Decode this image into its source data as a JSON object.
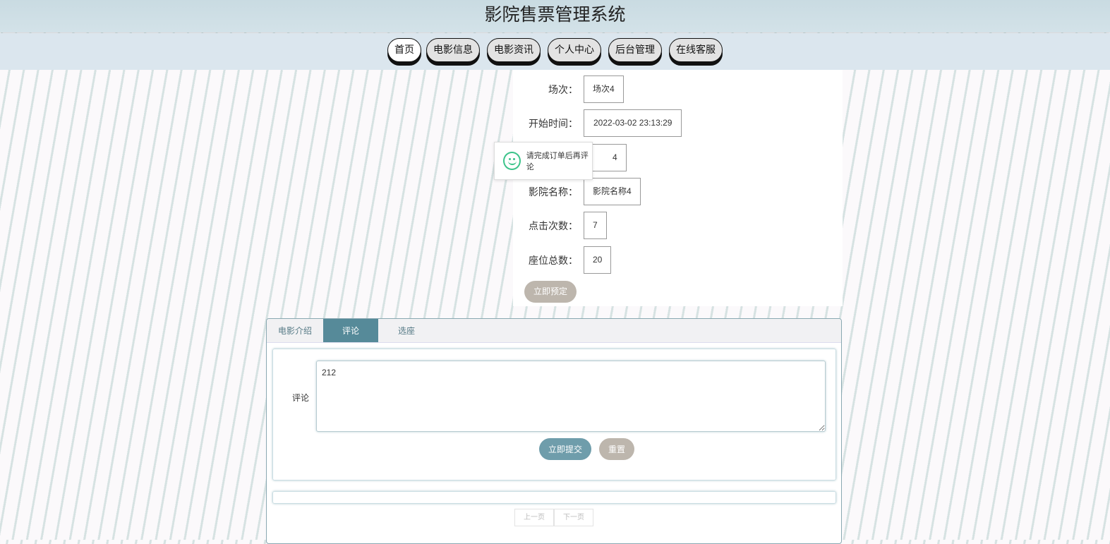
{
  "header": {
    "title": "影院售票管理系统"
  },
  "nav": [
    "首页",
    "电影信息",
    "电影资讯",
    "个人中心",
    "后台管理",
    "在线客服"
  ],
  "fields": [
    {
      "label": "场次：",
      "value": "场次4"
    },
    {
      "label": "开始时间：",
      "value": "2022-03-02 23:13:29"
    },
    {
      "label": "",
      "value": "4"
    },
    {
      "label": "影院名称：",
      "value": "影院名称4"
    },
    {
      "label": "点击次数：",
      "value": "7"
    },
    {
      "label": "座位总数：",
      "value": "20"
    }
  ],
  "book_label": "立即预定",
  "toast": {
    "message": "请完成订单后再评论",
    "icon": "smile-icon"
  },
  "tabs": [
    "电影介绍",
    "评论",
    "选座"
  ],
  "comment": {
    "label": "评论",
    "value": "212",
    "submit": "立即提交",
    "reset": "重置"
  },
  "pager": {
    "prev": "上一页",
    "next": "下一页"
  }
}
